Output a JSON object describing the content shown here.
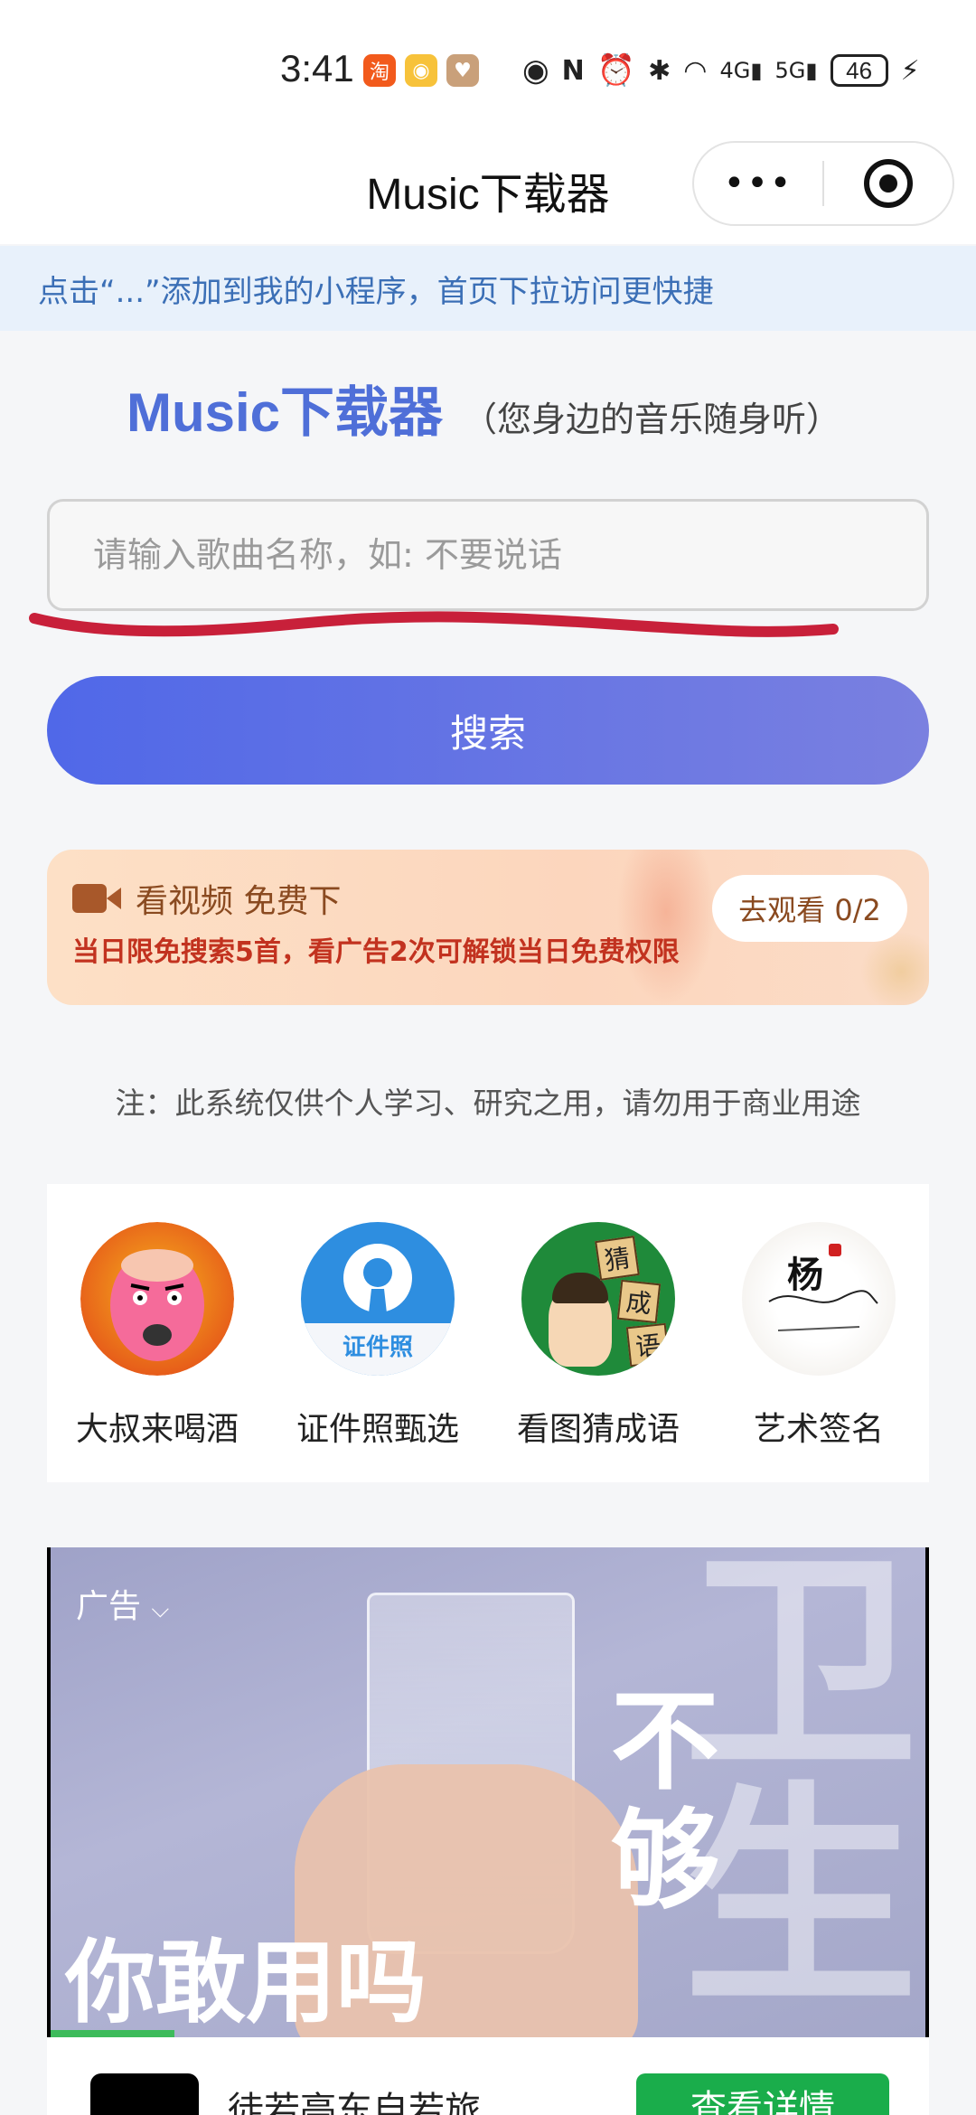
{
  "status_bar": {
    "time": "3:41",
    "app_icons": [
      "taobao-icon",
      "weibo-icon",
      "hand-heart-icon"
    ],
    "battery": "46",
    "system_icons": [
      "eye-icon",
      "nfc-icon",
      "alarm-icon",
      "bluetooth-icon",
      "wifi-icon",
      "signal-4g-icon",
      "signal-5g-icon",
      "charging-icon"
    ]
  },
  "nav": {
    "title": "Music下载器",
    "more_label": "•••"
  },
  "tip_banner": "点击“...”添加到我的小程序，首页下拉访问更快捷",
  "brand": {
    "name": "Music下载器",
    "subtitle": "（您身边的音乐随身听）"
  },
  "search": {
    "placeholder": "请输入歌曲名称，如: 不要说话",
    "button_label": "搜索"
  },
  "promo": {
    "title": "看视频 免费下",
    "description": "当日限免搜索5首，看广告2次可解锁当日免费权限",
    "button_label": "去观看 0/2"
  },
  "note": "注：此系统仅供个人学习、研究之用，请勿用于商业用途",
  "mini_apps": [
    {
      "label": "大叔来喝酒"
    },
    {
      "label": "证件照甄选",
      "badge": "证件照"
    },
    {
      "label": "看图猜成语",
      "tiles": [
        "猜",
        "成",
        "语"
      ]
    },
    {
      "label": "艺术签名",
      "mark": "杨"
    }
  ],
  "ad": {
    "label": "广告",
    "caption": "你敢用吗",
    "vertical_text": "不够",
    "big_chars": [
      "卫",
      "生"
    ],
    "progress": 0.14,
    "footer_text": "徒若亭东自若旅",
    "footer_button": "查看详情"
  },
  "colors": {
    "brand_blue": "#4f6fd8",
    "tip_blue": "#3b6fb6",
    "promo_red": "#c2321f",
    "ad_green": "#1aad4b"
  }
}
